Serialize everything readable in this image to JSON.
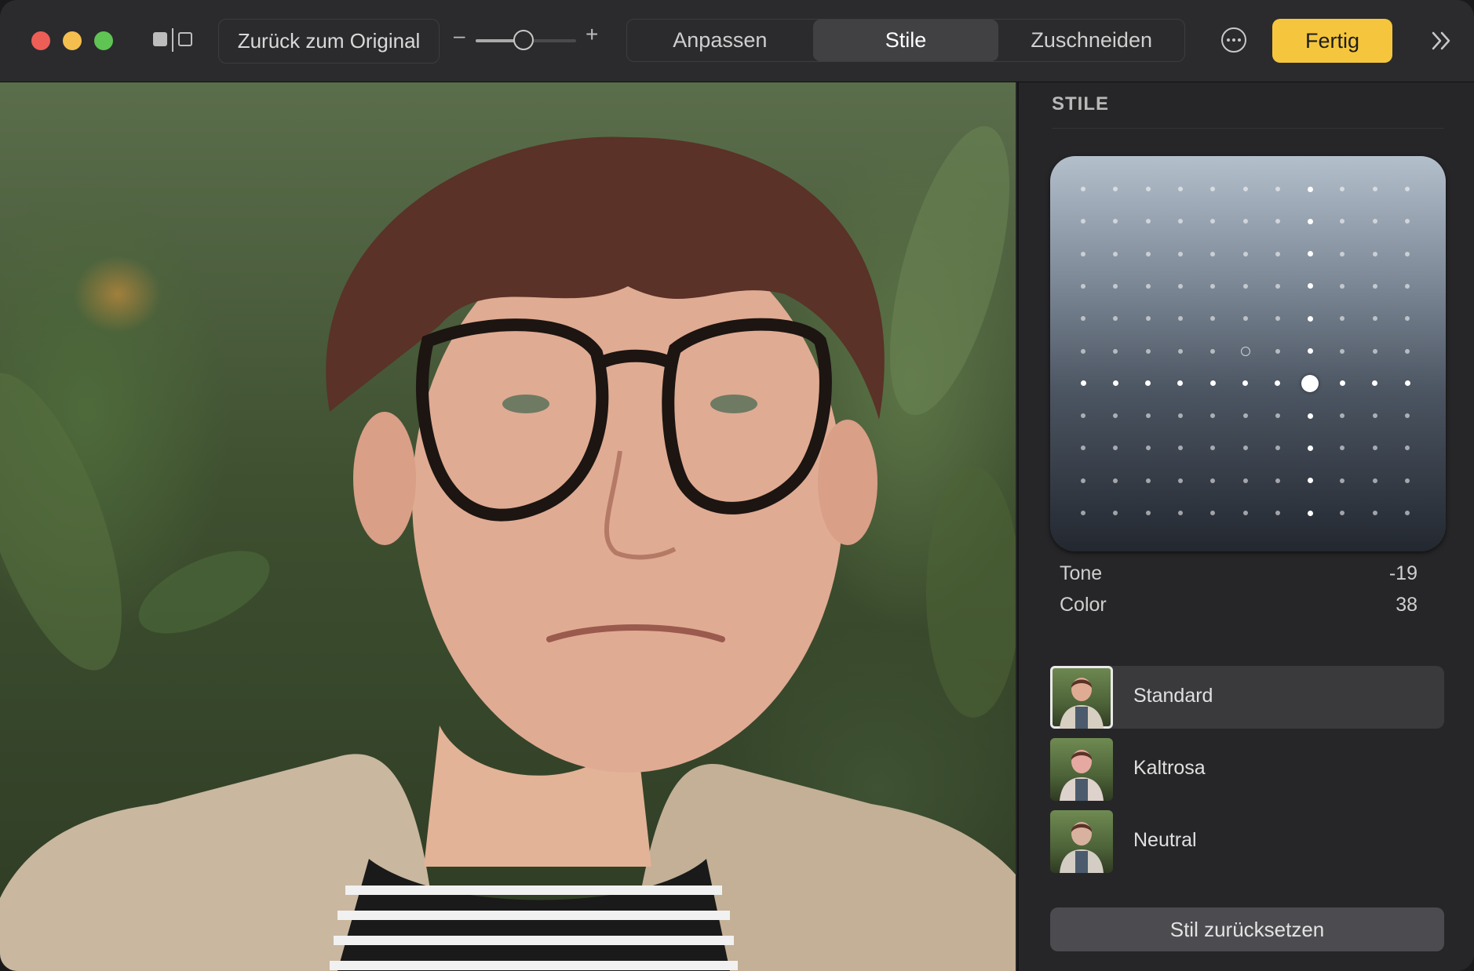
{
  "toolbar": {
    "revert_label": "Zurück zum Original",
    "zoom_minus": "–",
    "zoom_plus": "+",
    "zoom_level": 0.48,
    "tabs": [
      {
        "label": "Anpassen",
        "active": false
      },
      {
        "label": "Stile",
        "active": true
      },
      {
        "label": "Zuschneiden",
        "active": false
      }
    ],
    "done_label": "Fertig"
  },
  "sidebar": {
    "title": "STILE",
    "params": [
      {
        "label": "Tone",
        "value": "-19"
      },
      {
        "label": "Color",
        "value": "38"
      }
    ],
    "styles": [
      {
        "label": "Standard",
        "active": true
      },
      {
        "label": "Kaltrosa",
        "active": false
      },
      {
        "label": "Neutral",
        "active": false
      }
    ],
    "reset_label": "Stil zurücksetzen"
  },
  "colors": {
    "accent": "#f5c63d",
    "traffic_red": "#ed5e57",
    "traffic_yellow": "#f4bf4f",
    "traffic_green": "#5fc453"
  },
  "icons": [
    "compare-icon",
    "more-icon",
    "expand-sidebar-icon"
  ]
}
